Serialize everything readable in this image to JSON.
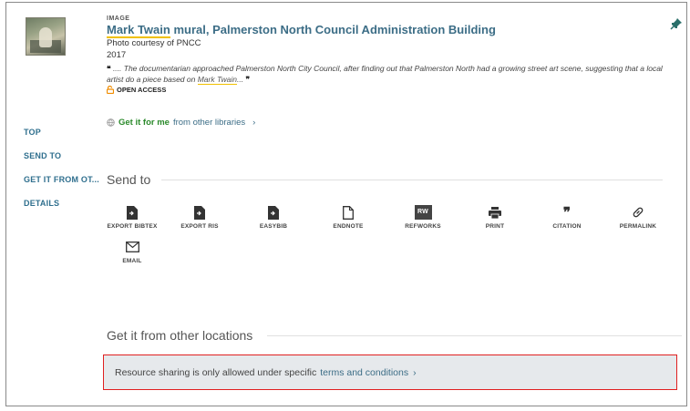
{
  "record": {
    "type": "IMAGE",
    "title_part1": "Mark Twain",
    "title_part2": " mural, Palmerston North Council Administration Building",
    "credit": "Photo courtesy of PNCC",
    "year": "2017",
    "snippet_open_quote": "❝",
    "snippet_text": " .... The documentarian approached Palmerston North City Council, after finding out that Palmerston North had a growing street art scene, suggesting that a local artist do a piece based on ",
    "snippet_highlight": "Mark Twain",
    "snippet_end": "...",
    "snippet_close_quote": "❞",
    "open_access": "OPEN ACCESS"
  },
  "getit": {
    "strong": "Get it for me",
    "rest": "from other libraries",
    "chevron": "›"
  },
  "nav": {
    "top": "TOP",
    "send_to": "SEND TO",
    "get_it": "GET IT FROM OT...",
    "details": "DETAILS"
  },
  "send_to": {
    "heading": "Send to",
    "actions": [
      {
        "label": "EXPORT BIBTEX",
        "icon": "file-export-icon"
      },
      {
        "label": "EXPORT RIS",
        "icon": "file-export-icon"
      },
      {
        "label": "EASYBIB",
        "icon": "file-export-icon"
      },
      {
        "label": "ENDNOTE",
        "icon": "file-outline-icon"
      },
      {
        "label": "REFWORKS",
        "icon": "refworks-icon",
        "icon_text": "RW"
      },
      {
        "label": "PRINT",
        "icon": "printer-icon"
      },
      {
        "label": "CITATION",
        "icon": "quote-icon"
      },
      {
        "label": "PERMALINK",
        "icon": "link-icon"
      },
      {
        "label": "EMAIL",
        "icon": "envelope-icon"
      }
    ]
  },
  "other_locations": {
    "heading": "Get it from other locations",
    "notice": "Resource sharing is only allowed under specific",
    "link": "terms and conditions",
    "chevron": "›"
  },
  "colors": {
    "link": "#3c6d86",
    "green": "#2b8a2b",
    "highlight": "#f0c000",
    "alert_border": "#e02020"
  }
}
